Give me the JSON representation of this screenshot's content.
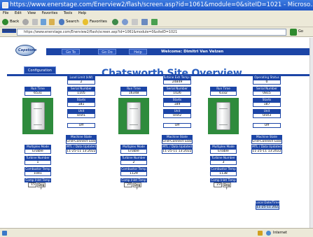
{
  "window": {
    "title": "https://www.enerstage.com/Enerview2/flash/screen.asp?id=1061&module=0&siteID=1021 - Microso..."
  },
  "menubar": {
    "items": [
      "File",
      "Edit",
      "View",
      "Favorites",
      "Tools",
      "Help"
    ]
  },
  "toolbar": {
    "back_label": "Back",
    "search_label": "Search",
    "favorites_label": "Favorites"
  },
  "address": {
    "label": "Address",
    "url": "https://www.enerstage.com/Enerview2/flash/screen.asp?id=1061&module=0&siteID=1021",
    "go_label": "Go"
  },
  "statusbar": {
    "zone": "Internet"
  },
  "app": {
    "logo_text": "Capstone",
    "nav": [
      "Go To",
      "Go Do",
      "Help"
    ],
    "welcome": "Welcome: Dimitri Van Velzen",
    "config_button": "Configuration",
    "title": "Chatsworth Site Overview",
    "local_date_time_label": "Local Date/Time",
    "local_date_time_value": "11-25-11 2022"
  },
  "units": [
    {
      "top_label": "Load Limit (kW)",
      "top_value": "2",
      "run_time_label": "Run Time",
      "run_time_value": "6531",
      "serial_label": "Serial Number",
      "serial_value": "1105",
      "starts_label": "Starts",
      "starts_value": "181",
      "unit_label": "Unit",
      "unit_value": "Unit1",
      "state_value": "Off",
      "machine_state_label": "Machine State",
      "machine_state_value": "Grid-Connect Load",
      "multiplex_label": "Multiplex Mode",
      "multiplex_value": "Enable",
      "mtl_label": "MTL / Data Updated",
      "mtl_value": "11-25-11 13:2022",
      "turbine_label": "Turbine Number",
      "turbine_value": "1",
      "combustor_label": "Combustor Temp",
      "combustor_value": "1041",
      "comp_label": "Comp Inlet Temp",
      "comp_value": "15",
      "comp_unit": "Deg F"
    },
    {
      "top_label": "Turbine Exh Temp (kW)",
      "top_value": "24849",
      "run_time_label": "Run Time",
      "run_time_value": "16348",
      "serial_label": "Serial Number",
      "serial_value": "1026",
      "starts_label": "Starts",
      "starts_value": "189",
      "unit_label": "Unit",
      "unit_value": "Unit2",
      "state_value": "Off",
      "machine_state_label": "Machine State",
      "machine_state_value": "Grid-Connect Load",
      "multiplex_label": "Multiplex Mode",
      "multiplex_value": "Enable",
      "mtl_label": "MTL / Data Updated",
      "mtl_value": "11-25-11 13:2022",
      "turbine_label": "Turbine Number",
      "turbine_value": "2",
      "combustor_label": "Combustor Temp",
      "combustor_value": "1129",
      "comp_label": "Comp Inlet Temp",
      "comp_value": "24",
      "comp_unit": "Deg F"
    },
    {
      "top_label": "Operating Status",
      "top_value": "0",
      "run_time_label": "Run Time",
      "run_time_value": "6332",
      "serial_label": "Serial Number",
      "serial_value": "0815",
      "starts_label": "Starts",
      "starts_value": "187",
      "unit_label": "Unit",
      "unit_value": "Unit3",
      "state_value": "Off",
      "machine_state_label": "Machine State",
      "machine_state_value": "Grid-Connect Load",
      "multiplex_label": "Multiplex Mode",
      "multiplex_value": "Enable",
      "mtl_label": "MTL / Data Updated",
      "mtl_value": "11-25-11 13:2022",
      "turbine_label": "Turbine Number",
      "turbine_value": "3",
      "combustor_label": "Combustor Temp",
      "combustor_value": "1138",
      "comp_label": "Comp Inlet Temp",
      "comp_value": "23",
      "comp_unit": "Deg F"
    }
  ]
}
